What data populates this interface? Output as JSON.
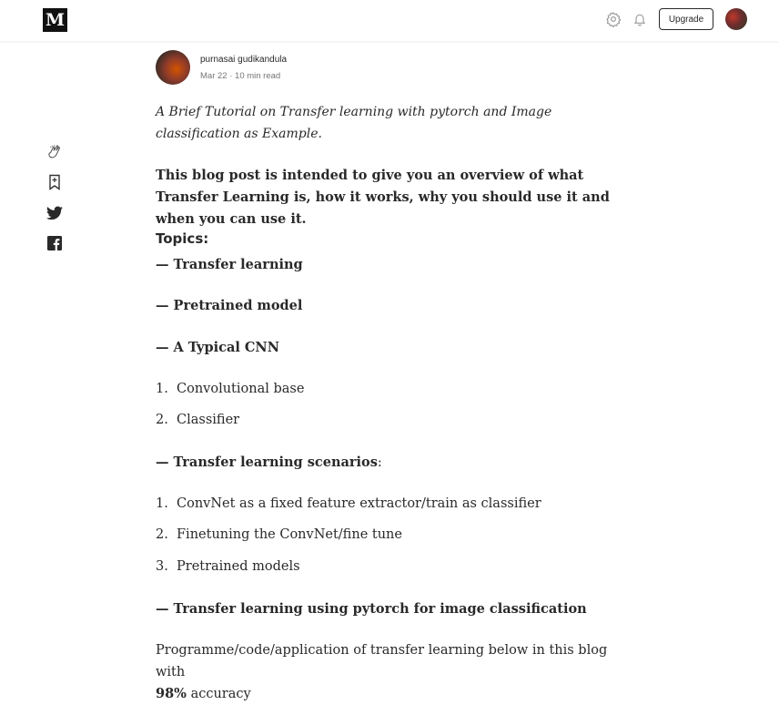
{
  "header": {
    "logo": "M",
    "upgrade_label": "Upgrade",
    "icons": [
      "settings-icon",
      "notifications-icon",
      "avatar"
    ]
  },
  "sidebar": {
    "icons": [
      "clap-icon",
      "bookmark-icon",
      "twitter-icon",
      "facebook-icon"
    ]
  },
  "author": {
    "name": "purnasai gudikandula",
    "date": "Mar 22",
    "read_time": "10 min read",
    "separator": "·"
  },
  "article": {
    "subtitle": "A Brief Tutorial on Transfer learning with pytorch and Image classification as Example.",
    "intro": "This blog post is intended to give you an overview of what Transfer Learning is, how it works, why you should use it and when you can use it.",
    "topics_heading": "Topics:",
    "topic_1": "— Transfer learning",
    "topic_2": "— Pretrained model",
    "topic_3": "— A Typical CNN",
    "cnn_list": [
      {
        "num": "1.",
        "text": "Convolutional base"
      },
      {
        "num": "2.",
        "text": "Classifier"
      }
    ],
    "topic_4_bold": "— Transfer learning scenarios",
    "topic_4_tail": ":",
    "scenario_list": [
      {
        "num": "1.",
        "text": "ConvNet as a fixed feature extractor/train as classifier"
      },
      {
        "num": "2.",
        "text": "Finetuning the ConvNet/fine tune"
      },
      {
        "num": "3.",
        "text": "Pretrained models"
      }
    ],
    "topic_5": "— Transfer learning using pytorch for image classification",
    "closing_text": "Programme/code/application of transfer learning below in this blog with",
    "closing_accuracy": "98%",
    "closing_tail": " accuracy"
  },
  "colors": {
    "text": "#292929",
    "muted": "#757575",
    "background": "#ffffff",
    "logo_bg": "#111111"
  }
}
